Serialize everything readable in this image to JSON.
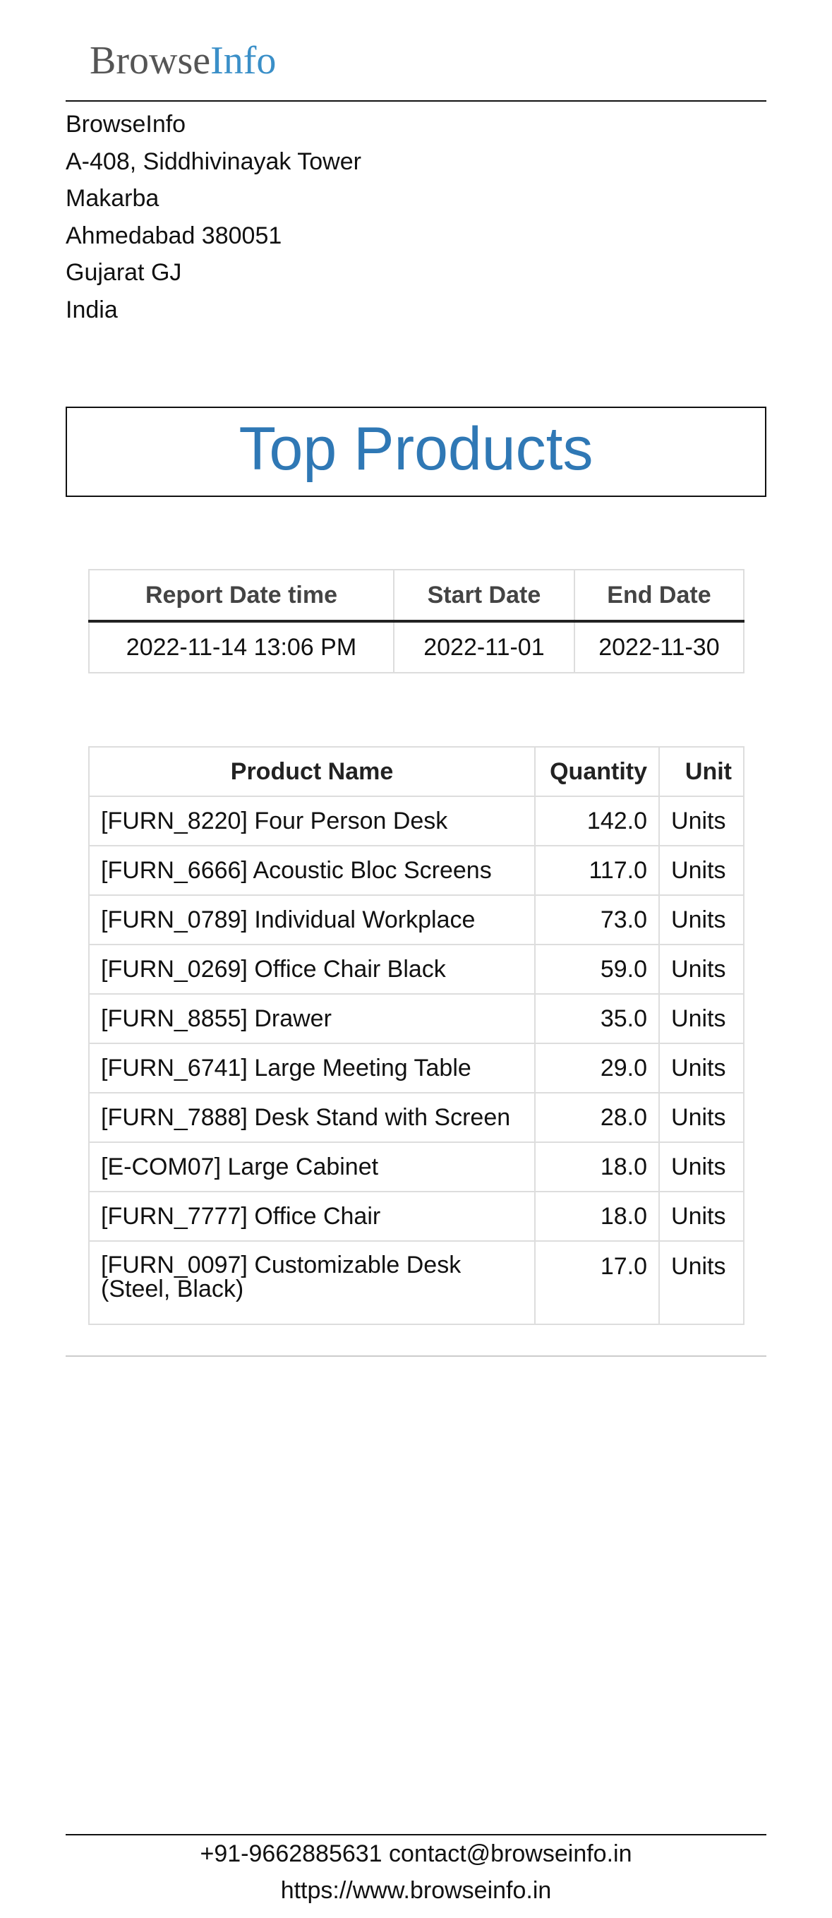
{
  "header": {
    "logo_browse": "Browse",
    "logo_info": "Info"
  },
  "address": {
    "lines": [
      "BrowseInfo",
      "A-408, Siddhivinayak Tower",
      "Makarba",
      "Ahmedabad 380051",
      "Gujarat GJ",
      "India"
    ]
  },
  "title": "Top Products",
  "report_info": {
    "headers": [
      "Report Date time",
      "Start Date",
      "End Date"
    ],
    "values": [
      "2022-11-14 13:06 PM",
      "2022-11-01",
      "2022-11-30"
    ]
  },
  "products": {
    "headers": [
      "Product Name",
      "Quantity",
      "Unit"
    ],
    "rows": [
      {
        "name": "[FURN_8220] Four Person Desk",
        "quantity": "142.0",
        "unit": "Units"
      },
      {
        "name": "[FURN_6666] Acoustic Bloc Screens",
        "quantity": "117.0",
        "unit": "Units"
      },
      {
        "name": "[FURN_0789] Individual Workplace",
        "quantity": "73.0",
        "unit": "Units"
      },
      {
        "name": "[FURN_0269] Office Chair Black",
        "quantity": "59.0",
        "unit": "Units"
      },
      {
        "name": "[FURN_8855] Drawer",
        "quantity": "35.0",
        "unit": "Units"
      },
      {
        "name": "[FURN_6741] Large Meeting Table",
        "quantity": "29.0",
        "unit": "Units"
      },
      {
        "name": "[FURN_7888] Desk Stand with Screen",
        "quantity": "28.0",
        "unit": "Units"
      },
      {
        "name": "[E-COM07] Large Cabinet",
        "quantity": "18.0",
        "unit": "Units"
      },
      {
        "name": "[FURN_7777] Office Chair",
        "quantity": "18.0",
        "unit": "Units"
      },
      {
        "name": "[FURN_0097] Customizable Desk (Steel, Black)",
        "quantity": "17.0",
        "unit": "Units"
      }
    ]
  },
  "footer": {
    "contact": "+91-9662885631 contact@browseinfo.in",
    "website": "https://www.browseinfo.in"
  },
  "colors": {
    "logo_info": "#3a8fc8",
    "title": "#2f78b5",
    "logo_browse": "#555555"
  }
}
